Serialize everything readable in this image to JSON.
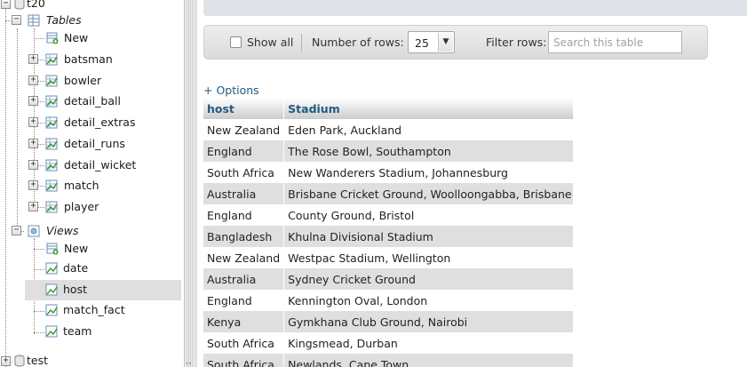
{
  "nav": {
    "db_name": "t20",
    "tables_label": "Tables",
    "tables_new": "New",
    "tables": [
      "batsman",
      "bowler",
      "detail_ball",
      "detail_extras",
      "detail_runs",
      "detail_wicket",
      "match",
      "player"
    ],
    "views_label": "Views",
    "views_new": "New",
    "views": [
      "date",
      "host",
      "match_fact",
      "team"
    ],
    "selected_view": "host",
    "next_db": "test"
  },
  "toolbar": {
    "show_all_label": "Show all",
    "rows_label": "Number of rows:",
    "rows_value": "25",
    "filter_label": "Filter rows:",
    "filter_placeholder": "Search this table"
  },
  "options_link": "+ Options",
  "table": {
    "columns": [
      "host",
      "Stadium"
    ],
    "rows": [
      [
        "New Zealand",
        "Eden Park, Auckland"
      ],
      [
        "England",
        "The Rose Bowl, Southampton"
      ],
      [
        "South Africa",
        "New Wanderers Stadium, Johannesburg"
      ],
      [
        "Australia",
        "Brisbane Cricket Ground, Woolloongabba, Brisbane"
      ],
      [
        "England",
        "County Ground, Bristol"
      ],
      [
        "Bangladesh",
        "Khulna Divisional Stadium"
      ],
      [
        "New Zealand",
        "Westpac Stadium, Wellington"
      ],
      [
        "Australia",
        "Sydney Cricket Ground"
      ],
      [
        "England",
        "Kennington Oval, London"
      ],
      [
        "Kenya",
        "Gymkhana Club Ground, Nairobi"
      ],
      [
        "South Africa",
        "Kingsmead, Durban"
      ],
      [
        "South Africa",
        "Newlands, Cape Town"
      ]
    ],
    "truncation_mark": "…"
  },
  "colors": {
    "link": "#235a81",
    "even_row": "#dfdfdf",
    "topbar": "#dfe3e8"
  }
}
